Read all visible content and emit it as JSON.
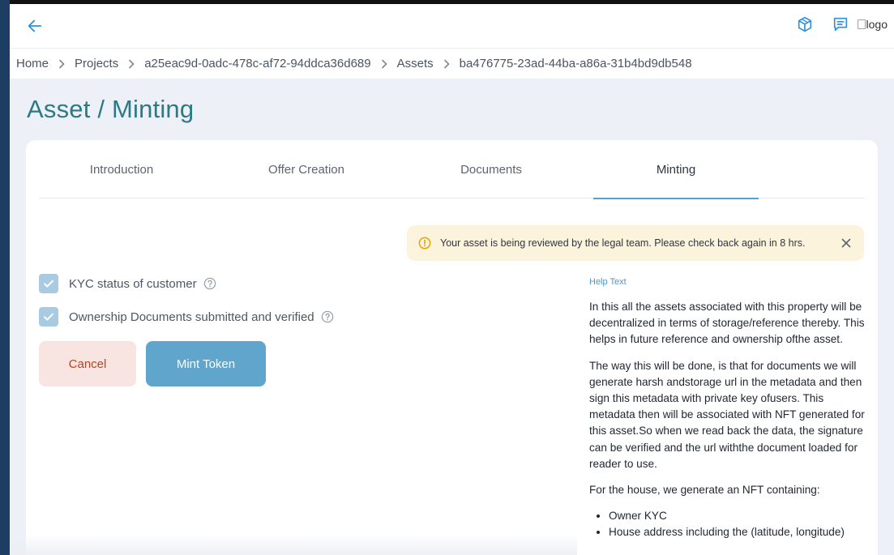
{
  "header": {
    "logo_alt": "logo",
    "icons": [
      "back-arrow-icon",
      "cube-icon",
      "chat-icon"
    ]
  },
  "breadcrumb": {
    "items": [
      "Home",
      "Projects",
      "a25eac9d-0adc-478c-af72-94ddca36d689",
      "Assets",
      "ba476775-23ad-44ba-a86a-31b4bd9db548"
    ]
  },
  "page": {
    "title": "Asset / Minting"
  },
  "tabs": [
    {
      "label": "Introduction"
    },
    {
      "label": "Offer Creation"
    },
    {
      "label": "Documents"
    },
    {
      "label": "Minting",
      "active": true
    }
  ],
  "alert": {
    "message": "Your asset is being reviewed by the legal team. Please check back again in 8 hrs."
  },
  "checklist": [
    {
      "label": "KYC status of customer",
      "checked": true
    },
    {
      "label": "Ownership Documents submitted and verified",
      "checked": true
    }
  ],
  "actions": {
    "cancel_label": "Cancel",
    "mint_label": "Mint Token"
  },
  "help": {
    "title": "Help Text",
    "paragraphs": [
      "In this all the assets associated with this property will be decentralized in terms of storage/reference thereby. This helps in future reference and ownership ofthe asset.",
      "The way this will be done, is that for documents we will generate harsh andstorage url in the metadata and then sign this metadata with private key ofusers. This metadata then will be associated with NFT generated for this asset.So when we read back the data, the signature can be verified and the url withthe document loaded for reader to use.",
      "For the house, we generate an NFT containing:"
    ],
    "bullets": [
      "Owner KYC",
      "House address including the (latitude, longitude)"
    ]
  },
  "colors": {
    "accent": "#5fa5cc",
    "title": "#2b7a86",
    "alert_bg": "#fcf3dc",
    "cancel_bg": "#f8e5e1",
    "cancel_text": "#c0431e"
  }
}
